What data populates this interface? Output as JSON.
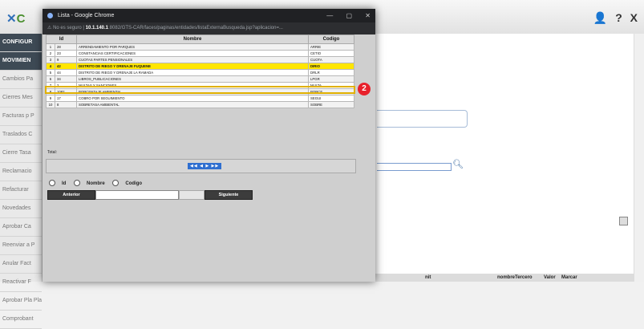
{
  "app": {
    "logo": "C",
    "top_icons": [
      "user-icon",
      "?",
      "X"
    ],
    "nav_items": [
      "CONFIGUR",
      "MOVIMIEN",
      "Cambios Pa",
      "Cierres Mes",
      "Facturas p P",
      "Traslados C",
      "Cierre Tasa",
      "Reclamacio",
      "Refacturar",
      "Novedades",
      "Aprobar Ca",
      "Reenviar a P",
      "Anular Fact",
      "Reactivar F",
      "Aprobar Pla Plano",
      "Comprobant"
    ],
    "bottom_headers": [
      "nit",
      "nombreTercero",
      "Valor",
      "Marcar"
    ]
  },
  "popup": {
    "title": "Lista - Google Chrome",
    "window_controls": [
      "—",
      "▢",
      "✕"
    ],
    "address_prefix": "No es seguro",
    "address_host": "10.1.140.1",
    "address_rest": ":8082/GTS-CAR/faces/paginas/entidades/listaExternaBusqueda.jsp?aplicacion=...",
    "columns": [
      "Id",
      "Nombre",
      "Codigo"
    ],
    "rows": [
      {
        "n": "1",
        "id": "28",
        "nombre": "ARRENDAMIENTO POR PARQUES",
        "codigo": "ARRIE"
      },
      {
        "n": "2",
        "id": "23",
        "nombre": "CONSTANCIAS CERTIFICACIONES",
        "codigo": "CETIO"
      },
      {
        "n": "3",
        "id": "9",
        "nombre": "CUOTAS PARTES PENSIONALES",
        "codigo": "CUOTA"
      },
      {
        "n": "4",
        "id": "42",
        "nombre": "DISTRITO DE RIEGO Y DRENAJE FUQUENE",
        "codigo": "DIRIO"
      },
      {
        "n": "5",
        "id": "44",
        "nombre": "DISTRITO DE RIEGO Y DRENAJE LA RAMADA",
        "codigo": "DRLR"
      },
      {
        "n": "6",
        "id": "34",
        "nombre": "LIBROS_PUBLICACIONES",
        "codigo": "LPGR"
      },
      {
        "n": "7",
        "id": "2",
        "nombre": "MULTAS Y SANCIONES",
        "codigo": "MULTA"
      },
      {
        "n": "8",
        "id": "1082",
        "nombre": "PORCENTAJE AMBIENTAL",
        "codigo": "PORCE"
      },
      {
        "n": "9",
        "id": "17",
        "nombre": "COBRO POR SEGUIMIENTO",
        "codigo": "SEGUI"
      },
      {
        "n": "10",
        "id": "8",
        "nombre": "SOBRETASA AMBIENTAL",
        "codigo": "SOBRE"
      }
    ],
    "selected_index": 3,
    "badge": "2",
    "total_label": "Total:",
    "pager_nav": "◀◀ ◀ ▶ ▶▶",
    "radio_options": [
      "Id",
      "Nombre",
      "Codigo"
    ],
    "btn_previous": "Anterior",
    "btn_next": "Siguiente"
  }
}
